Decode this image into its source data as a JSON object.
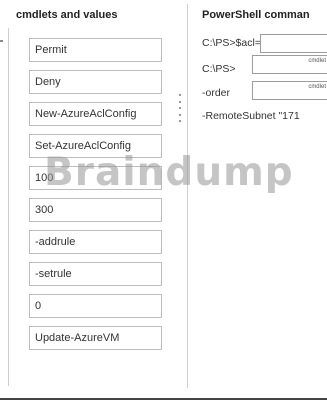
{
  "left_panel": {
    "heading": "cmdlets and values",
    "items": [
      "Permit",
      "Deny",
      "New-AzureAclConfig",
      "Set-AzureAclConfig",
      "100",
      "300",
      "-addrule",
      "-setrule",
      "0",
      "Update-AzureVM"
    ]
  },
  "right_panel": {
    "heading": "PowerShell comman",
    "line1_prefix": "C:\\PS>$acl=",
    "line1_slot": "",
    "line2_prefix": "C:\\PS>",
    "line2_slot": "cmdlet or",
    "line3_prefix": "-order",
    "line3_slot": "cmdlet or",
    "line4_text": "-RemoteSubnet \"171"
  },
  "watermark": {
    "text": "Braindump"
  },
  "colors": {
    "border": "#bdbdbd",
    "slot_border": "#9c9c9c",
    "divider": "#cfcfcf",
    "bottom_rule": "#444444",
    "text": "#333333"
  }
}
